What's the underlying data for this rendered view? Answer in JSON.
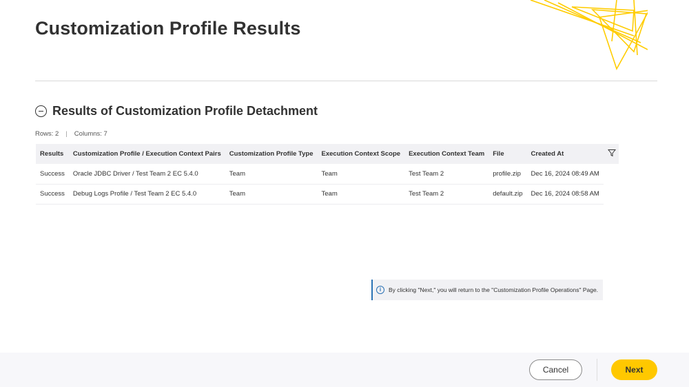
{
  "page": {
    "title": "Customization Profile Results"
  },
  "section": {
    "title": "Results of Customization Profile Detachment",
    "rows_label": "Rows: 2",
    "sep": "|",
    "columns_label": "Columns: 7"
  },
  "table": {
    "headers": {
      "results": "Results",
      "pairs": "Customization Profile / Execution Context Pairs",
      "type": "Customization Profile Type",
      "scope": "Execution Context Scope",
      "team": "Execution Context Team",
      "file": "File",
      "created": "Created At"
    },
    "rows": [
      {
        "result": "Success",
        "pair": "Oracle JDBC Driver / Test Team 2 EC 5.4.0",
        "type": "Team",
        "scope": "Team",
        "team": "Test Team 2",
        "file": "profile.zip",
        "created": "Dec 16, 2024 08:49 AM"
      },
      {
        "result": "Success",
        "pair": "Debug Logs Profile / Test Team 2 EC 5.4.0",
        "type": "Team",
        "scope": "Team",
        "team": "Test Team 2",
        "file": "default.zip",
        "created": "Dec 16, 2024 08:58 AM"
      }
    ]
  },
  "info": {
    "icon": "info-icon",
    "text": "By clicking \"Next,\" you will return to the \"Customization Profile Operations\" Page."
  },
  "footer": {
    "cancel_label": "Cancel",
    "next_label": "Next"
  },
  "colors": {
    "accent": "#ffc800",
    "success": "#1a9c3a",
    "info": "#2a72b5"
  }
}
